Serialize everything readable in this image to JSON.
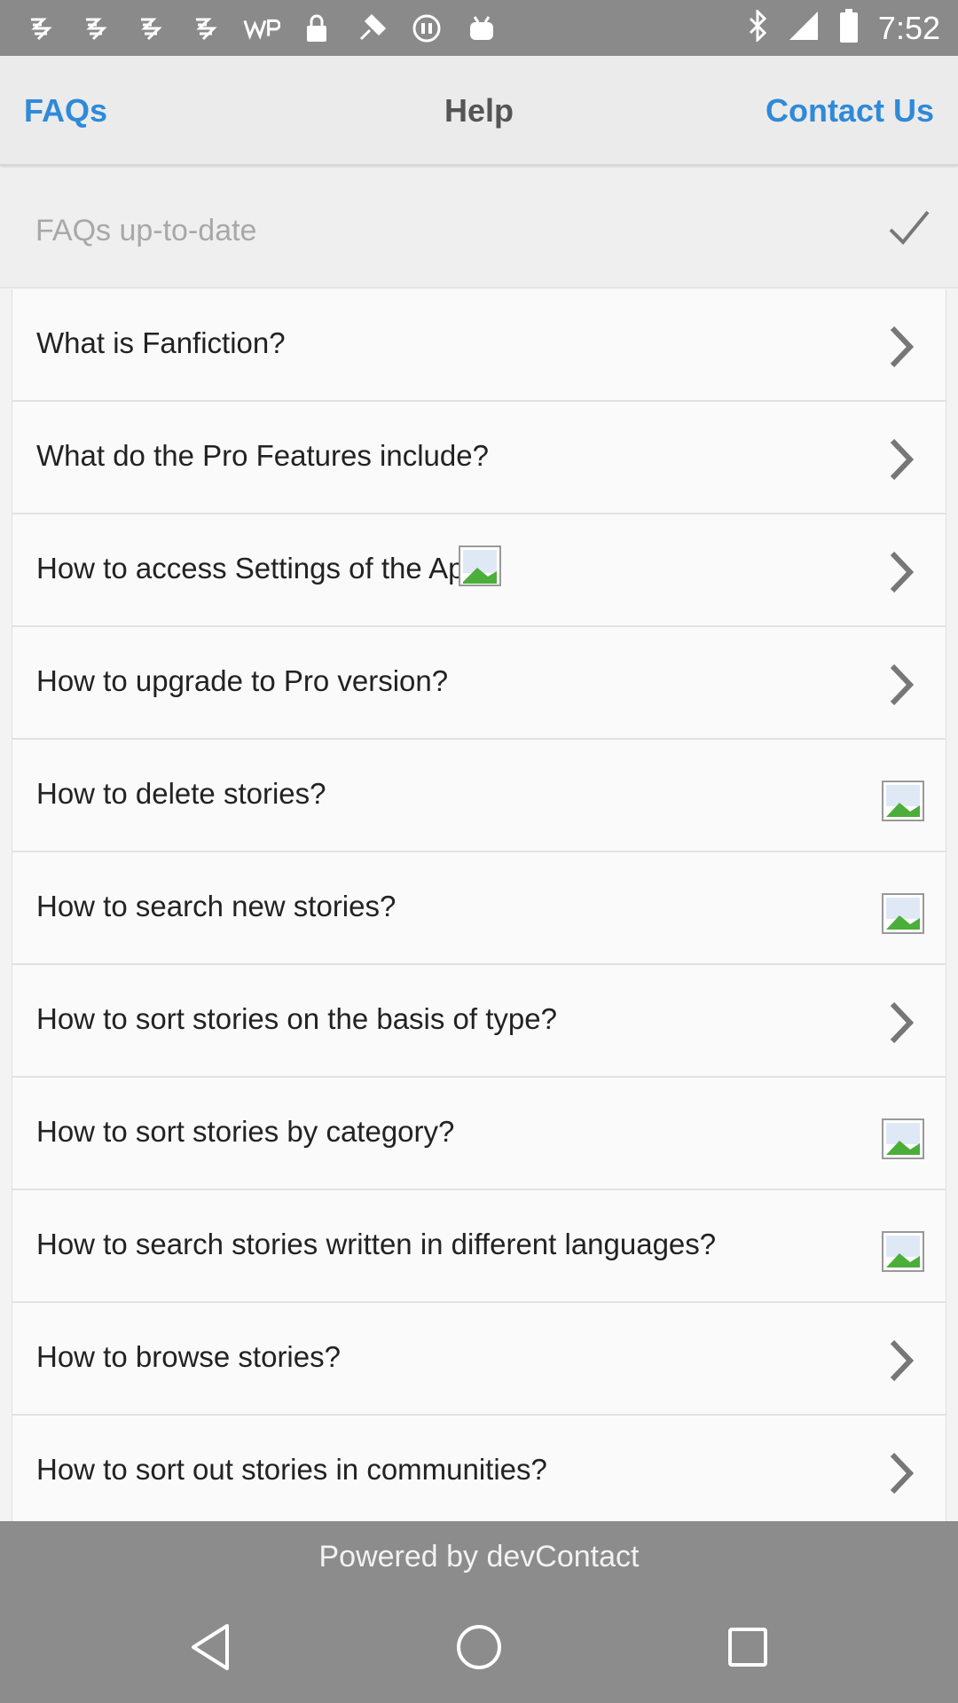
{
  "status_bar": {
    "time": "7:52",
    "left_icons": [
      "notification-icon",
      "notification-icon",
      "notification-icon",
      "notification-icon",
      "wp-icon",
      "lock-icon",
      "satellite-icon",
      "circle-icon",
      "android-icon"
    ],
    "right_icons": [
      "bluetooth-icon",
      "signal-icon",
      "battery-icon"
    ]
  },
  "header": {
    "left_link": "FAQs",
    "title": "Help",
    "right_link": "Contact Us"
  },
  "status_row": {
    "text": "FAQs up-to-date",
    "icon": "check-icon"
  },
  "faqs": [
    {
      "question": "What is Fanfiction?",
      "trail": "chevron-right-icon"
    },
    {
      "question": "What do the Pro Features include?",
      "trail": "chevron-right-icon"
    },
    {
      "question": "How to access Settings of the App?",
      "trail": "chevron-right-icon"
    },
    {
      "question": "How to upgrade to Pro version?",
      "trail": "chevron-right-icon"
    },
    {
      "question": "How to delete stories?",
      "trail": "broken-image-icon"
    },
    {
      "question": "How to search new stories?",
      "trail": "broken-image-icon"
    },
    {
      "question": "How to sort stories on the basis of type?",
      "trail": "chevron-right-icon"
    },
    {
      "question": "How to sort stories by category?",
      "trail": "broken-image-icon"
    },
    {
      "question": "How to search stories written in different languages?",
      "trail": "broken-image-icon"
    },
    {
      "question": "How to browse stories?",
      "trail": "chevron-right-icon"
    },
    {
      "question": "How to sort out stories in communities?",
      "trail": "chevron-right-icon"
    }
  ],
  "footer": {
    "text": "Powered by devContact"
  },
  "system_nav": {
    "back": "back-icon",
    "home": "home-icon",
    "recents": "recents-icon"
  },
  "colors": {
    "link": "#2f8ad8",
    "status_bar": "#8a8a8a",
    "footer": "#8c8c8c"
  }
}
